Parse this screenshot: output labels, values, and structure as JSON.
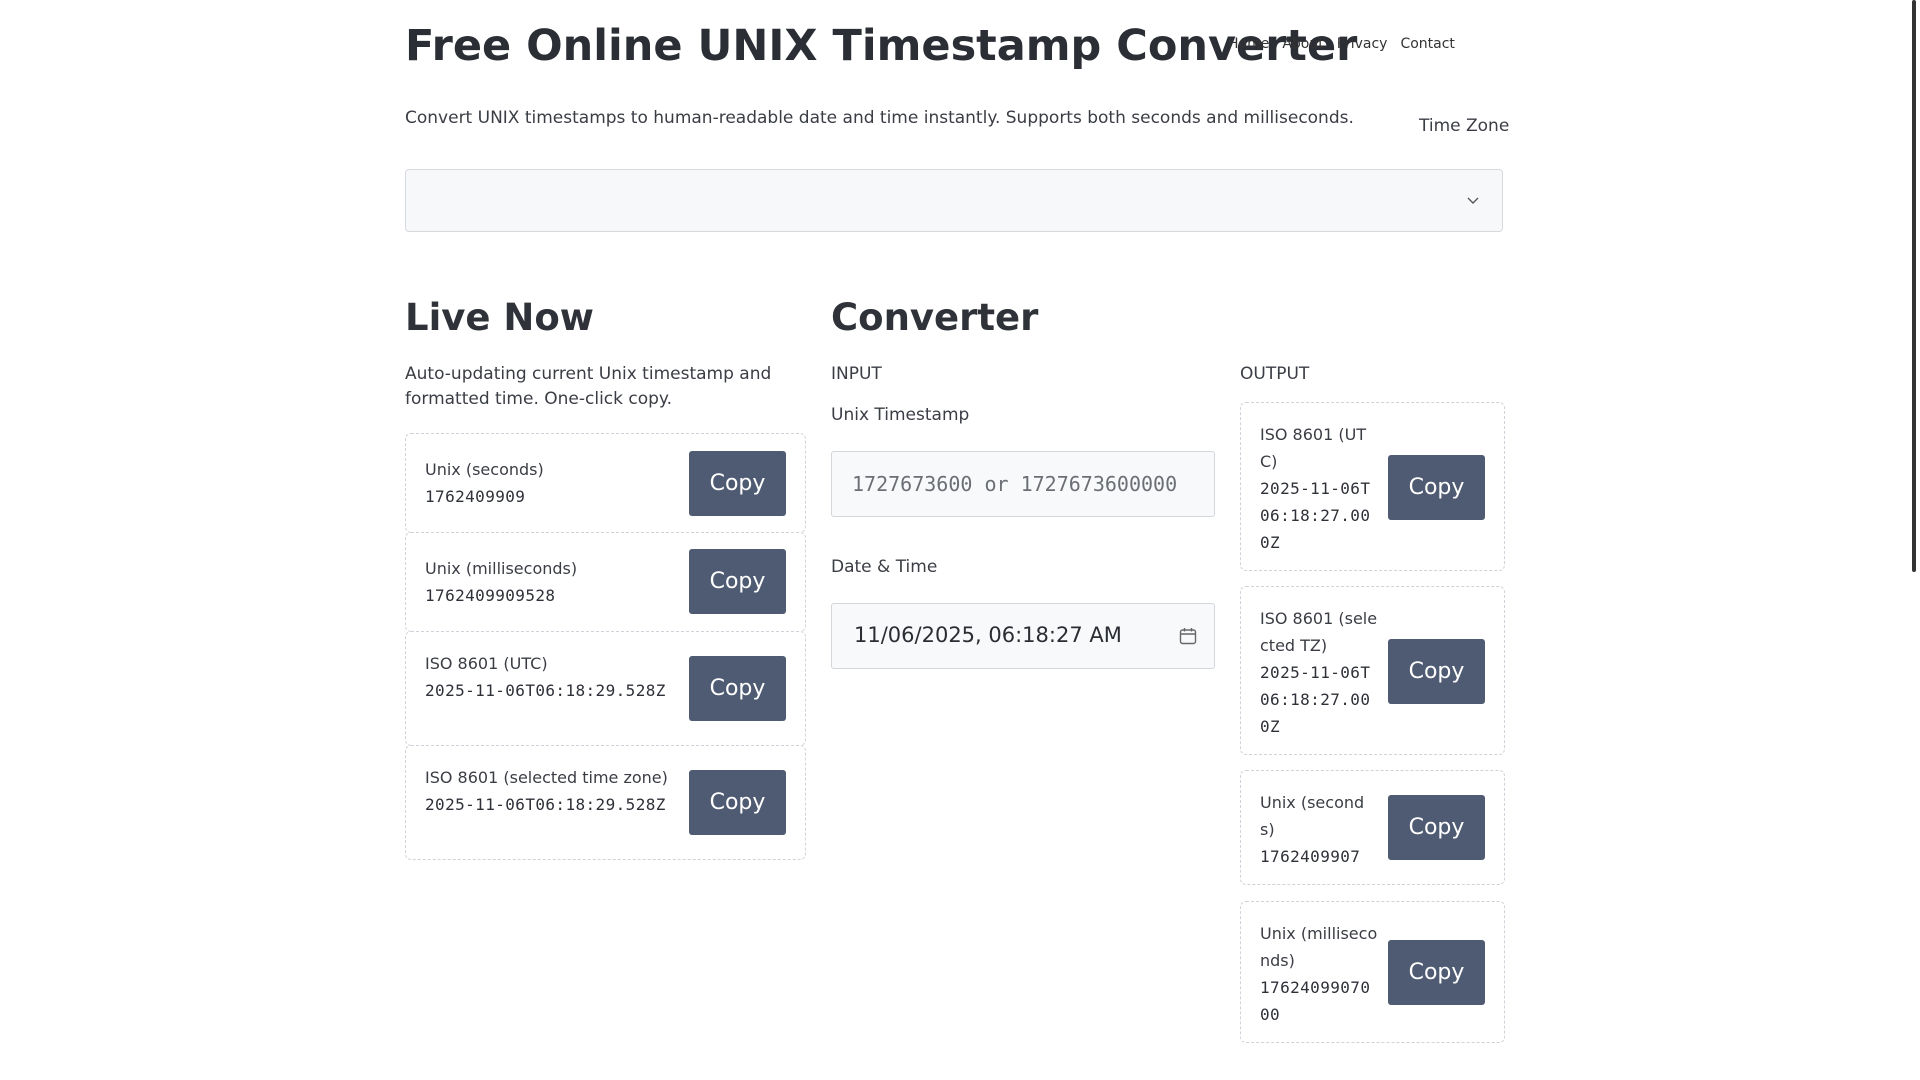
{
  "header": {
    "title": "Free Online UNIX Timestamp Converter",
    "nav": [
      "Home",
      "About",
      "Privacy",
      "Contact"
    ],
    "subtitle": "Convert UNIX timestamps to human-readable date and time instantly. Supports both seconds and milliseconds.",
    "timezone_label": "Time Zone",
    "timezone_value": ""
  },
  "live": {
    "heading": "Live Now",
    "description": "Auto-updating current Unix timestamp and formatted time. One-click copy.",
    "cards": [
      {
        "label": "Unix (seconds)",
        "value": "1762409909",
        "button": "Copy"
      },
      {
        "label": "Unix (milliseconds)",
        "value": "1762409909528",
        "button": "Copy"
      },
      {
        "label": "ISO 8601 (UTC)",
        "value": "2025-11-06T06:18:29.528Z",
        "button": "Copy"
      },
      {
        "label": "ISO 8601 (selected time zone)",
        "value": "2025-11-06T06:18:29.528Z",
        "button": "Copy"
      }
    ]
  },
  "converter": {
    "heading": "Converter",
    "input_heading": "INPUT",
    "output_heading": "OUTPUT",
    "unix_label": "Unix Timestamp",
    "unix_placeholder": "1727673600 or 1727673600000",
    "unix_value": "",
    "datetime_label": "Date & Time",
    "datetime_value": "11/06/2025, 06:18:27 AM",
    "outputs": [
      {
        "label": "ISO 8601 (UTC)",
        "value": "2025-11-06T06:18:27.000Z",
        "button": "Copy"
      },
      {
        "label": "ISO 8601 (selected TZ)",
        "value": "2025-11-06T06:18:27.000Z",
        "button": "Copy"
      },
      {
        "label": "Unix (seconds)",
        "value": "1762409907",
        "button": "Copy"
      },
      {
        "label": "Unix (milliseconds)",
        "value": "1762409907000",
        "button": "Copy"
      }
    ]
  },
  "icons": {
    "dropdown": "chevron-down-icon",
    "calendar": "calendar-icon"
  },
  "colors": {
    "button": "#4f5b72",
    "text": "#2e3138"
  }
}
